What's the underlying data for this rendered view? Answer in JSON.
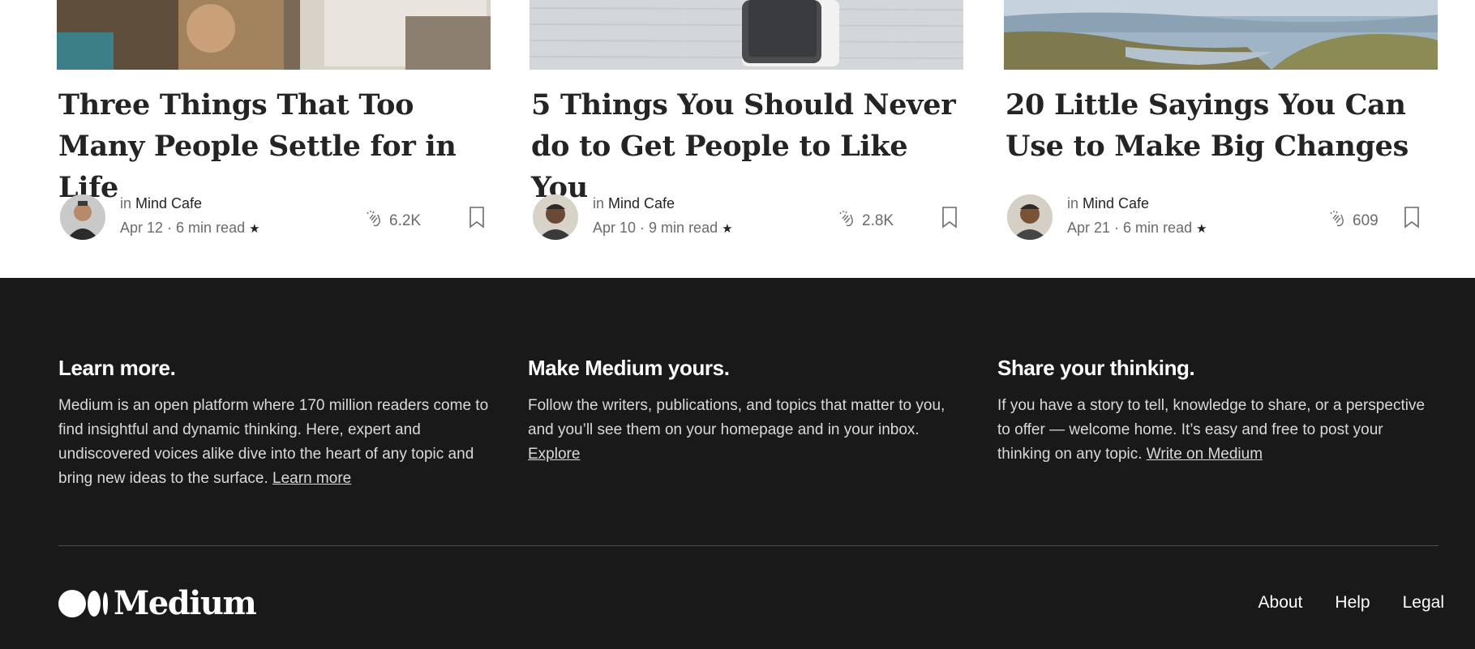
{
  "articles": [
    {
      "title": "Three Things That Too Many People Settle for in Life",
      "pub_prefix": "in ",
      "publication": "Mind Cafe",
      "date": "Apr 12",
      "read_time": "6 min read",
      "claps": "6.2K"
    },
    {
      "title": "5 Things You Should Never do to Get People to Like You",
      "pub_prefix": "in ",
      "publication": "Mind Cafe",
      "date": "Apr 10",
      "read_time": "9 min read",
      "claps": "2.8K"
    },
    {
      "title": "20 Little Sayings You Can Use to Make Big Changes",
      "pub_prefix": "in ",
      "publication": "Mind Cafe",
      "date": "Apr 21",
      "read_time": "6 min read",
      "claps": "609"
    }
  ],
  "meta_separator": " · ",
  "star": "★",
  "footer": {
    "learn": {
      "heading": "Learn more.",
      "body": "Medium is an open platform where 170 million readers come to find insightful and dynamic thinking. Here, expert and undiscovered voices alike dive into the heart of any topic and bring new ideas to the surface. ",
      "link": "Learn more"
    },
    "yours": {
      "heading": "Make Medium yours.",
      "body": "Follow the writers, publications, and topics that matter to you, and you’ll see them on your homepage and in your inbox. ",
      "link": "Explore"
    },
    "share": {
      "heading": "Share your thinking.",
      "body": "If you have a story to tell, knowledge to share, or a perspective to offer — welcome home. It’s easy and free to post your thinking on any topic. ",
      "link": "Write on Medium"
    },
    "logo_text": "Medium",
    "links": [
      "About",
      "Help",
      "Legal"
    ]
  },
  "colors": {
    "footer_bg": "#191919",
    "text_dark": "#242424",
    "text_muted": "#6b6b6b"
  }
}
